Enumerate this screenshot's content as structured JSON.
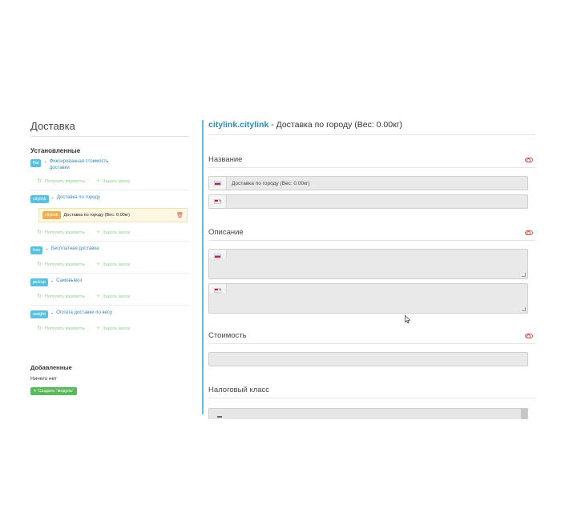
{
  "left": {
    "title": "Доставка",
    "installed_heading": "Установленные",
    "modules": [
      {
        "code": "flat",
        "name": "Фиксированная стоимость доставки"
      },
      {
        "code": "citylink",
        "name": "Доставка по городу"
      },
      {
        "code": "free",
        "name": "Бесплатная доставка"
      },
      {
        "code": "pickup",
        "name": "Самовывоз"
      },
      {
        "code": "weight",
        "name": "Оплата доставки по весу"
      }
    ],
    "sub_item": {
      "code": "citylink",
      "label": "Доставка по городу (Вес: 0.00кг)"
    },
    "action_get_variants": "Получить варианты",
    "action_set_mask": "Задать маску",
    "added_heading": "Добавленные",
    "nothing": "Ничего нет",
    "create_button": "Создать \"модуль\""
  },
  "right": {
    "header_code": "citylink.citylink",
    "header_rest": " - Доставка по городу (Вес: 0.00кг)",
    "name_label": "Название",
    "name_ru_value": "Доставка по городу  (Вес: 0.00кг)",
    "name_en_value": "",
    "description_label": "Описание",
    "cost_label": "Стоимость",
    "tax_label": "Налоговый класс"
  },
  "colors": {
    "accent": "#5bc0de",
    "header_code": "#2a8bb5",
    "danger": "#d9534f",
    "success": "#5cb85c",
    "highlight": "#f0ad4e"
  }
}
